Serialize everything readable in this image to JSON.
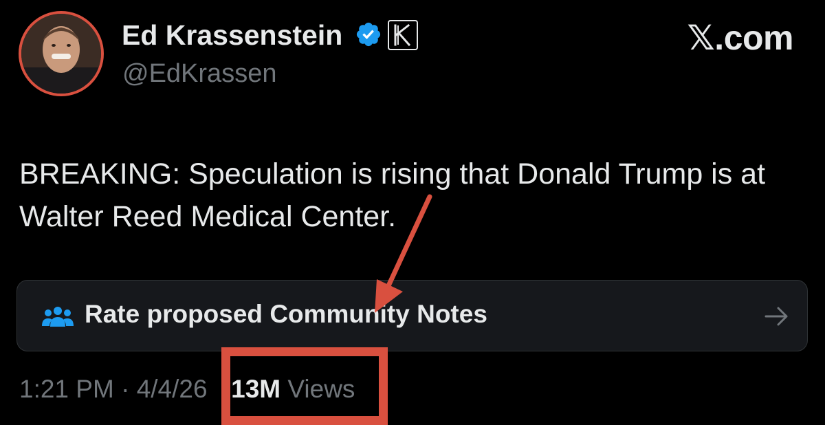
{
  "author": {
    "display_name": "Ed Krassenstein",
    "handle": "@EdKrassen",
    "verified_badge": "verified-check-icon",
    "affiliate_badge": "K"
  },
  "watermark": "𝕏.com",
  "tweet": {
    "text": "BREAKING: Speculation is rising that Donald Trump is at Walter Reed Medical Center."
  },
  "community_notes": {
    "label": "Rate proposed Community Notes",
    "icon": "people-icon",
    "chevron": "arrow-right-icon"
  },
  "meta": {
    "time": "1:21 PM",
    "separator": "·",
    "date": "4/4/26",
    "views_count": "13M",
    "views_label": "Views"
  },
  "colors": {
    "background": "#000000",
    "text_primary": "#e7e9ea",
    "text_secondary": "#71767b",
    "verified_blue": "#1d9bf0",
    "annotation_red": "#d9503f",
    "card_background": "#16181c"
  }
}
